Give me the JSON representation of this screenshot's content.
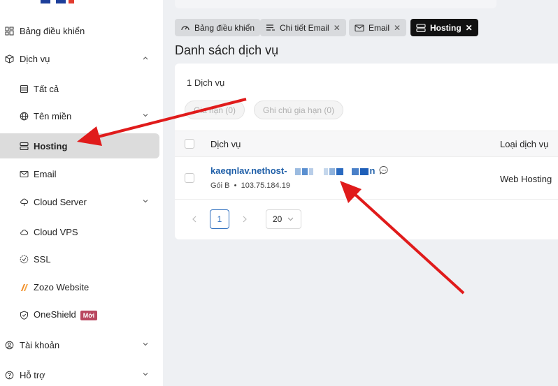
{
  "sidebar": {
    "items": [
      {
        "label": "Bảng điều khiển",
        "icon": "dashboard-icon"
      },
      {
        "label": "Dịch vụ",
        "icon": "box-icon"
      },
      {
        "label": "Tất cả",
        "icon": "list-icon"
      },
      {
        "label": "Tên miền",
        "icon": "globe-icon"
      },
      {
        "label": "Hosting",
        "icon": "server-icon"
      },
      {
        "label": "Email",
        "icon": "mail-icon"
      },
      {
        "label": "Cloud Server",
        "icon": "cloud-server-icon"
      },
      {
        "label": "Cloud VPS",
        "icon": "cloud-icon"
      },
      {
        "label": "SSL",
        "icon": "ssl-icon"
      },
      {
        "label": "Zozo Website",
        "icon": "zozo-icon"
      },
      {
        "label": "OneShield",
        "icon": "shield-icon",
        "badge": "Mới"
      },
      {
        "label": "Tài khoản",
        "icon": "user-icon"
      },
      {
        "label": "Hỗ trợ",
        "icon": "support-icon"
      }
    ]
  },
  "tabs": [
    {
      "label": "Bảng điều khiển"
    },
    {
      "label": "Chi tiết Email"
    },
    {
      "label": "Email"
    },
    {
      "label": "Hosting"
    }
  ],
  "page_title": "Danh sách dịch vụ",
  "count_label": "1 Dịch vụ",
  "actions": {
    "renew": "Gia hạn (0)",
    "renew_note": "Ghi chú gia hạn (0)"
  },
  "table": {
    "headers": {
      "service": "Dịch vụ",
      "type": "Loại dịch vụ"
    },
    "rows": [
      {
        "name_prefix": "kaeqnlav.nethost-",
        "name_suffix": "n",
        "plan": "Gói B",
        "ip": "103.75.184.19",
        "type": "Web Hosting"
      }
    ]
  },
  "pagination": {
    "current": "1",
    "page_size": "20"
  },
  "colors": {
    "accent": "#1f5fa8",
    "arrow": "#e01b1b",
    "badge": "#b9475f"
  }
}
